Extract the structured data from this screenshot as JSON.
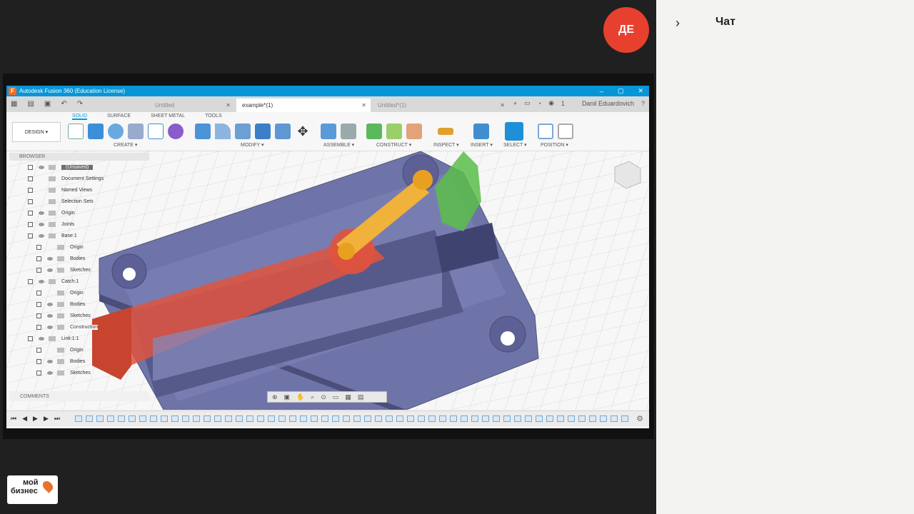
{
  "avatar": {
    "initials": "ДЕ",
    "color": "#e8402f"
  },
  "chat": {
    "title": "Чат",
    "toggle_icon": "chevron-right-icon"
  },
  "logo": {
    "line1": "мой",
    "line2": "бизнес"
  },
  "fusion": {
    "window_title": "Autodesk Fusion 360 (Education License)",
    "app_icon": "F",
    "tabs": [
      {
        "label": "Untitled",
        "active": false
      },
      {
        "label": "example*(1)",
        "active": true
      },
      {
        "label": "Untitled*(1)",
        "active": false
      }
    ],
    "user": "Danil Eduardovich",
    "notification_count": "1",
    "workspace_tabs": [
      "SOLID",
      "SURFACE",
      "SHEET METAL",
      "TOOLS"
    ],
    "design_button": "DESIGN ▾",
    "groups": [
      "CREATE ▾",
      "MODIFY ▾",
      "ASSEMBLE ▾",
      "CONSTRUCT ▾",
      "INSPECT ▾",
      "INSERT ▾",
      "SELECT ▾",
      "POSITION ▾"
    ],
    "browser": {
      "header": "BROWSER",
      "root": "(Unsaved)",
      "items": [
        "Document Settings",
        "Named Views",
        "Selection Sets",
        "Origin",
        "Joints",
        "Base:1",
        "Origin",
        "Bodies",
        "Sketches",
        "Catch:1",
        "Origin",
        "Bodies",
        "Sketches",
        "Construction",
        "Link:1:1",
        "Origin",
        "Bodies",
        "Sketches"
      ]
    },
    "comments": "COMMENTS",
    "colors": {
      "accent": "#0696d7",
      "base": "#6f74a8",
      "catch": "#e0533e",
      "link": "#f0b23a",
      "handle": "#5cbd4a"
    }
  }
}
